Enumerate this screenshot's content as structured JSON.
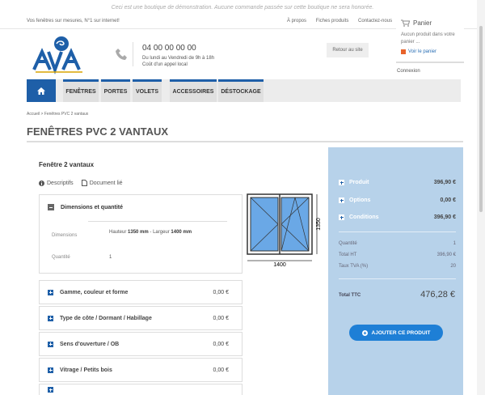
{
  "demo_banner": "Ceci est une boutique de démonstration. Aucune commande passée sur cette boutique ne sera honorée.",
  "topbar": {
    "tagline": "Vos fenêtres sur mesures, N°1 sur internet!",
    "links": [
      "À propos",
      "Fiches produits",
      "Contactez-nous"
    ]
  },
  "cart": {
    "title": "Panier",
    "empty_text": "Aucun produit dans votre panier ...",
    "view_label": "Voir le panier"
  },
  "login_label": "Connexion",
  "contact": {
    "phone": "04 00 00 00 00",
    "hours_line1": "Du lundi au Vendredi de 9h à 18h",
    "hours_line2": "Coût d'un appel local"
  },
  "back_button": "Retour au site",
  "menu": [
    "FENÊTRES",
    "PORTES",
    "VOLETS",
    "ACCESSOIRES",
    "DÉSTOCKAGE"
  ],
  "breadcrumb": "Accueil  >  Fenêtres PVC 2 vantaux",
  "page_title": "FENÊTRES PVC 2 VANTAUX",
  "product": {
    "title": "Fenêtre 2 vantaux",
    "tabs": [
      "Descriptifs",
      "Document lié"
    ],
    "panel_title": "Dimensions et quantité",
    "dim_label": "Dimensions",
    "height_label": "Hauteur",
    "height_value": "1350 mm",
    "width_label": "Largeur",
    "width_value": "1400 mm",
    "qty_label": "Quantité",
    "qty_value": "1",
    "diagram_height": "1350",
    "diagram_width": "1400"
  },
  "options": [
    {
      "label": "Gamme, couleur et forme",
      "price": "0,00 €"
    },
    {
      "label": "Type de côte / Dormant / Habillage",
      "price": "0,00 €"
    },
    {
      "label": "Sens d'ouverture / OB",
      "price": "0,00 €"
    },
    {
      "label": "Vitrage / Petits bois",
      "price": "0,00 €"
    }
  ],
  "summary": {
    "rows": [
      {
        "label": "Produit",
        "value": "396,90 €"
      },
      {
        "label": "Options",
        "value": "0,00 €"
      },
      {
        "label": "Conditions",
        "value": "396,90 €"
      }
    ],
    "info": [
      {
        "label": "Quantité",
        "value": "1"
      },
      {
        "label": "Total HT",
        "value": "396,90 €"
      },
      {
        "label": "Taux TVA (%)",
        "value": "20"
      }
    ],
    "total_label": "Total TTC",
    "total_value": "476,28 €",
    "add_button": "AJOUTER CE PRODUIT"
  },
  "colors": {
    "primary": "#1e5fa8",
    "button": "#1e7fd6",
    "sidebar": "#b7d2ea",
    "accent": "#e8632b"
  }
}
